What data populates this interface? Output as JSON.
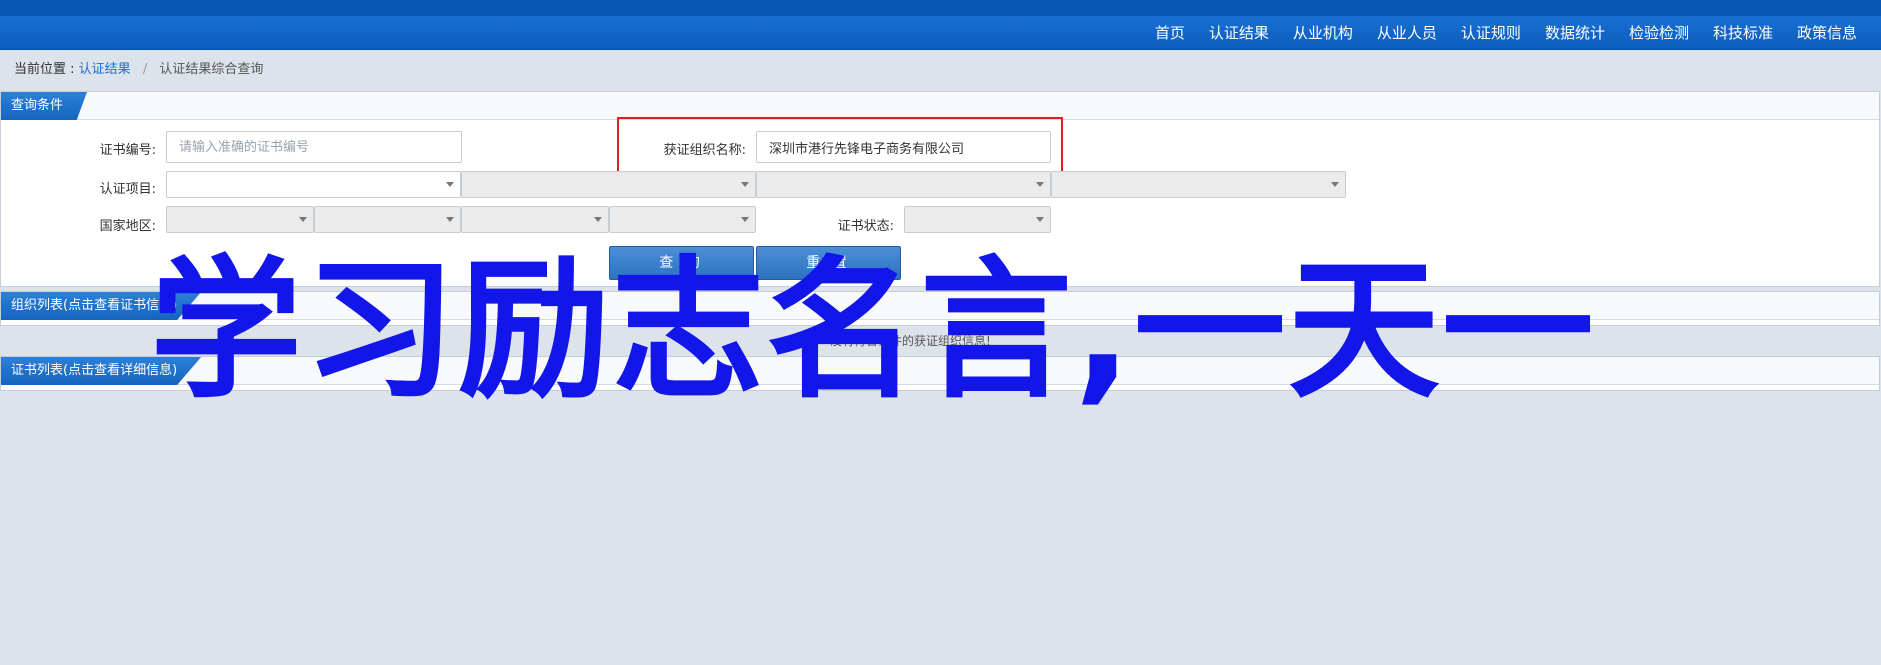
{
  "nav": {
    "items": [
      "首页",
      "认证结果",
      "从业机构",
      "从业人员",
      "认证规则",
      "数据统计",
      "检验检测",
      "科技标准",
      "政策信息"
    ]
  },
  "breadcrumb": {
    "prefix": "当前位置 :",
    "link": "认证结果",
    "separator": "/",
    "current": "认证结果综合查询"
  },
  "query_panel": {
    "title": "查询条件",
    "cert_number_label": "证书编号:",
    "cert_number_placeholder": "请输入准确的证书编号",
    "org_name_label": "获证组织名称:",
    "org_name_value": "深圳市港行先锋电子商务有限公司",
    "cert_project_label": "认证项目:",
    "region_label": "国家地区:",
    "cert_status_label": "证书状态:",
    "search_button": "查 询",
    "reset_button": "重 置"
  },
  "org_list_panel": {
    "title": "组织列表(点击查看证书信息)",
    "empty_message": "没有符合条件的获证组织信息!"
  },
  "cert_list_panel": {
    "title": "证书列表(点击查看详细信息)"
  },
  "overlay_text": "学习励志名言,一天一",
  "colors": {
    "nav_bg": "#0c5cbd",
    "panel_head": "#1565c0",
    "highlight": "#e02020",
    "overlay": "#1316e8"
  }
}
